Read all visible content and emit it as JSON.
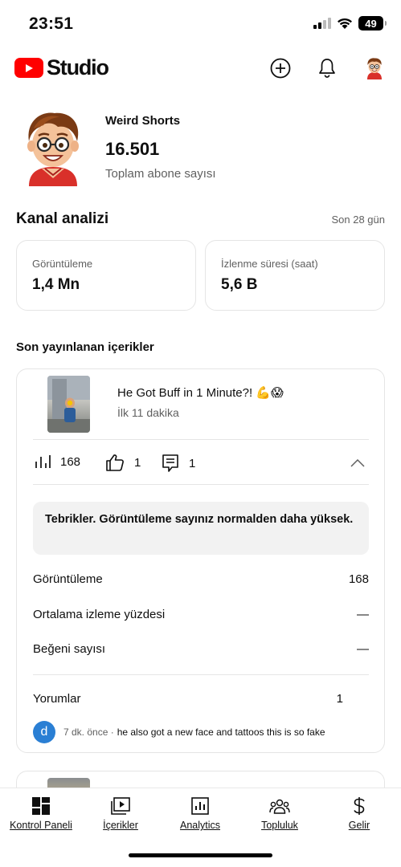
{
  "status_bar": {
    "time": "23:51",
    "battery": "49"
  },
  "app": {
    "logo_text": "Studio"
  },
  "channel": {
    "name": "Weird Shorts",
    "subscriber_count": "16.501",
    "subscriber_label": "Toplam abone sayısı"
  },
  "analytics": {
    "title": "Kanal analizi",
    "period": "Son 28 gün",
    "metrics": [
      {
        "label": "Görüntüleme",
        "value": "1,4 Mn"
      },
      {
        "label": "İzlenme süresi (saat)",
        "value": "5,6 B"
      }
    ]
  },
  "recent": {
    "title": "Son yayınlanan içerikler",
    "video": {
      "title": "He Got Buff in 1 Minute?! 💪😱",
      "subtitle": "İlk 11 dakika",
      "views": "168",
      "likes": "1",
      "comments": "1"
    },
    "notice": "Tebrikler. Görüntüleme sayınız normalden daha yüksek.",
    "details": [
      {
        "label": "Görüntüleme",
        "value": "168"
      },
      {
        "label": "Ortalama izleme yüzdesi",
        "value": "—"
      },
      {
        "label": "Beğeni sayısı",
        "value": "—"
      }
    ],
    "comments_row": {
      "label": "Yorumlar",
      "value": "1"
    },
    "latest_comment": {
      "avatar_letter": "d",
      "time": "7 dk. önce ·",
      "text": "he also got a new face and tattoos this is so fake"
    }
  },
  "bottom_nav": [
    {
      "label": "Kontrol Paneli",
      "icon": "dashboard-icon"
    },
    {
      "label": "İçerikler",
      "icon": "content-icon"
    },
    {
      "label": "Analytics",
      "icon": "analytics-icon"
    },
    {
      "label": "Topluluk",
      "icon": "community-icon"
    },
    {
      "label": "Gelir",
      "icon": "dollar-icon"
    }
  ],
  "colors": {
    "brand_red": "#ff0000",
    "comment_avatar": "#2a7fd4",
    "notice_bg": "#f2f2f2"
  }
}
